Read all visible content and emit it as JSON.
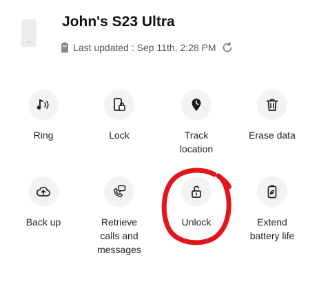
{
  "device": {
    "name": "John's S23 Ultra",
    "last_updated": "Last updated : Sep 11th, 2:28 PM",
    "thumbnail_icon": "phone-thumbnail",
    "battery_icon": "battery-icon",
    "refresh_icon": "refresh-icon"
  },
  "actions": [
    {
      "id": "ring",
      "label": "Ring",
      "icon": "ring-icon"
    },
    {
      "id": "lock",
      "label": "Lock",
      "icon": "lock-phone-icon"
    },
    {
      "id": "track",
      "label": "Track\nlocation",
      "icon": "location-pin-icon"
    },
    {
      "id": "erase",
      "label": "Erase data",
      "icon": "trash-icon"
    },
    {
      "id": "backup",
      "label": "Back up",
      "icon": "cloud-upload-icon"
    },
    {
      "id": "retrieve",
      "label": "Retrieve\ncalls and\nmessages",
      "icon": "call-message-icon"
    },
    {
      "id": "unlock",
      "label": "Unlock",
      "icon": "unlock-icon"
    },
    {
      "id": "extend",
      "label": "Extend\nbattery life",
      "icon": "battery-leaf-icon"
    }
  ],
  "highlight": {
    "color": "#e3141b",
    "target": "unlock"
  }
}
